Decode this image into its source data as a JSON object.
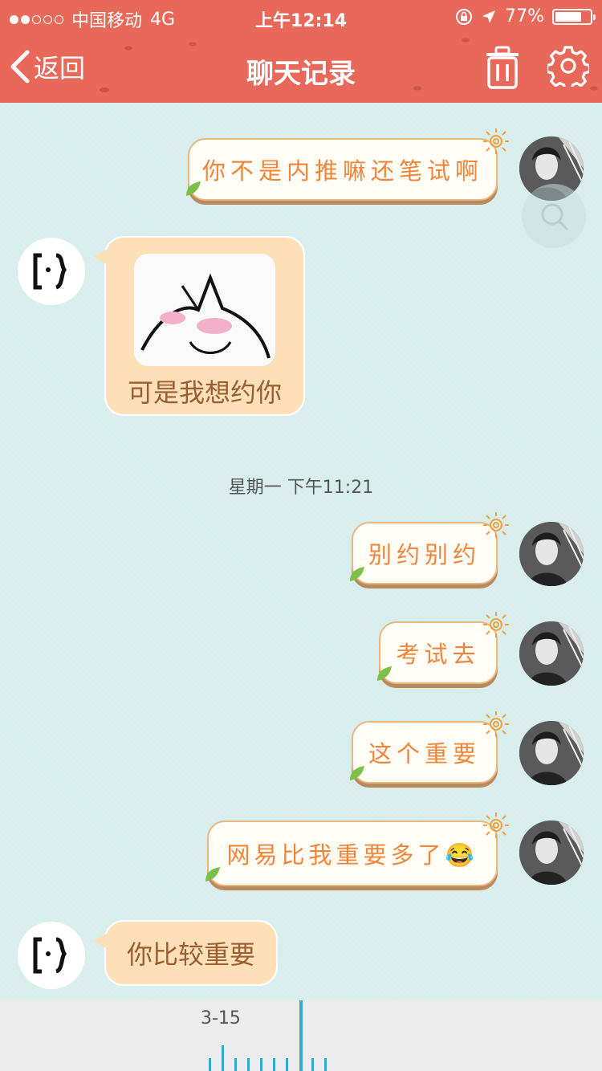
{
  "status_bar": {
    "carrier": "中国移动",
    "network": "4G",
    "time": "上午12:14",
    "battery": "77%",
    "battery_level": 0.77
  },
  "nav": {
    "back_label": "返回",
    "title": "聊天记录"
  },
  "messages": [
    {
      "side": "right",
      "text": "你不是内推嘛还笔试啊"
    },
    {
      "side": "left",
      "type": "sticker",
      "text": "可是我想约你"
    },
    {
      "type": "timestamp",
      "text": "星期一 下午11:21"
    },
    {
      "side": "right",
      "text": "别约别约"
    },
    {
      "side": "right",
      "text": "考试去"
    },
    {
      "side": "right",
      "text": "这个重要"
    },
    {
      "side": "right",
      "text": "网易比我重要多了😂"
    },
    {
      "side": "left",
      "text": "你比较重要"
    }
  ],
  "timeline": {
    "date_label": "3-15"
  },
  "colors": {
    "header": "#e8695a",
    "chat_bg": "#d8eeec",
    "right_bubble_text": "#f0853a",
    "left_bubble_bg": "#fde0b8",
    "accent": "#3aa7d9"
  },
  "icons": [
    "chevron-left-icon",
    "trash-icon",
    "gear-icon",
    "search-icon",
    "sun-icon",
    "leaf-icon",
    "location-arrow-icon",
    "rotation-lock-icon"
  ]
}
